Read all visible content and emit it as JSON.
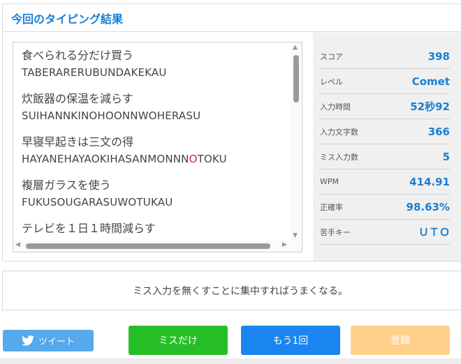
{
  "header": {
    "title": "今回のタイピング結果"
  },
  "entries": [
    {
      "jp": "食べられる分だけ買う",
      "roma": "TABERARERUBUNDAKEKAU"
    },
    {
      "jp": "炊飯器の保温を減らす",
      "roma": "SUIHANNKINOHOONNWOHERASU"
    },
    {
      "jp": "早寝早起きは三文の得",
      "roma_before": "HAYANEHAYAOKIHASANMONNN",
      "roma_miss": "O",
      "roma_after": "TOKU"
    },
    {
      "jp": "複層ガラスを使う",
      "roma": "FUKUSOUGARASUWOTUKAU"
    },
    {
      "jp": "テレビを１日１時間減らす"
    }
  ],
  "stats": [
    {
      "label": "スコア",
      "value": "398"
    },
    {
      "label": "レベル",
      "value": "Comet"
    },
    {
      "label": "入力時間",
      "value": "52秒92"
    },
    {
      "label": "入力文字数",
      "value": "366"
    },
    {
      "label": "ミス入力数",
      "value": "5"
    },
    {
      "label": "WPM",
      "value": "414.91"
    },
    {
      "label": "正確率",
      "value": "98.63%"
    },
    {
      "label": "苦手キー",
      "value": "ＵＴＯ"
    }
  ],
  "advice": {
    "text": "ミス入力を無くすことに集中すればうまくなる。"
  },
  "buttons": {
    "tweet": "ツイート",
    "miss_only": "ミスだけ",
    "again": "もう1回",
    "register": "登録"
  },
  "colors": {
    "accent": "#1a7fd4",
    "miss_red": "#e02020",
    "tweet": "#55a9ec",
    "miss_only": "#27bf27",
    "again": "#1a84f0",
    "register": "#ffd08a"
  }
}
